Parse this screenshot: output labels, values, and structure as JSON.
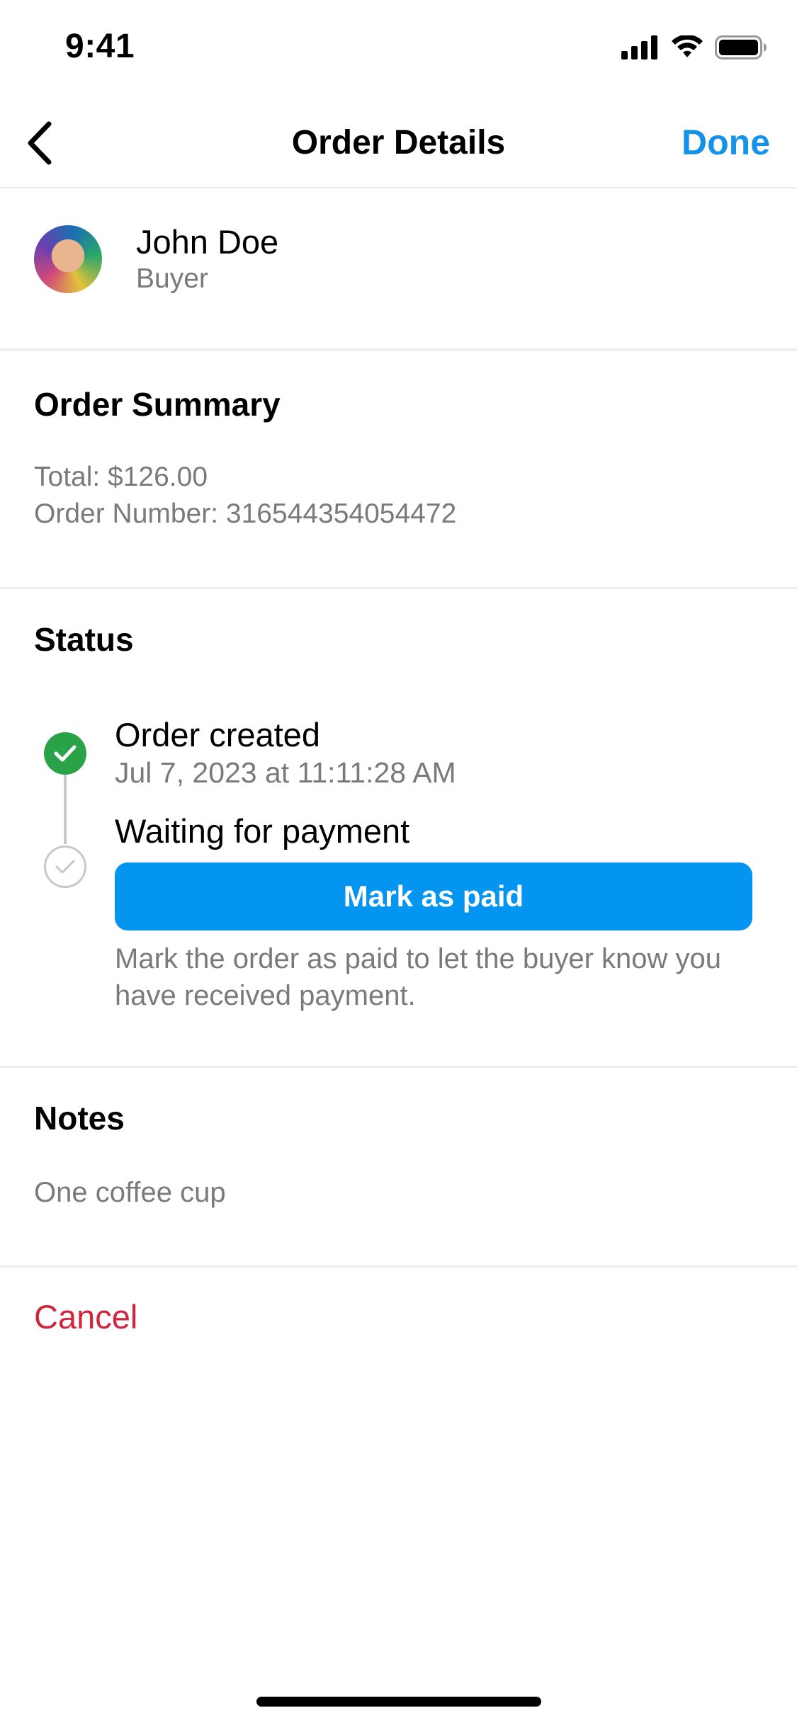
{
  "status_bar": {
    "time": "9:41",
    "icons": [
      "signal-icon",
      "wifi-icon",
      "battery-icon"
    ]
  },
  "nav": {
    "back_icon": "chevron-left-icon",
    "title": "Order Details",
    "done_label": "Done"
  },
  "buyer": {
    "name": "John Doe",
    "role": "Buyer"
  },
  "order_summary": {
    "title": "Order Summary",
    "total": "Total: $126.00",
    "order_number": "Order Number: 316544354054472"
  },
  "status": {
    "title": "Status",
    "steps": [
      {
        "label": "Order created",
        "timestamp": "Jul 7, 2023 at 11:11:28 AM",
        "state": "complete"
      },
      {
        "label": "Waiting for payment",
        "state": "pending"
      }
    ],
    "action_label": "Mark as paid",
    "action_help": "Mark the order as paid to let the buyer know you have received payment."
  },
  "notes": {
    "title": "Notes",
    "text": "One coffee cup"
  },
  "cancel_label": "Cancel",
  "colors": {
    "accent": "#1493e8",
    "button": "#0395f0",
    "success": "#2aa247",
    "destructive": "#d0253a",
    "secondary_text": "#7a7a7e"
  }
}
